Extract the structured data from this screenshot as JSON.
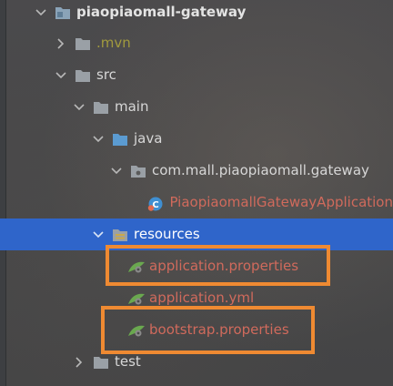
{
  "tree": {
    "project": {
      "label": "piaopiaomall-gateway"
    },
    "mvn": {
      "label": ".mvn"
    },
    "src": {
      "label": "src"
    },
    "main": {
      "label": "main"
    },
    "java": {
      "label": "java"
    },
    "package": {
      "label": "com.mall.piaopiaomall.gateway"
    },
    "app_class": {
      "label": "PiaopiaomallGatewayApplication"
    },
    "resources": {
      "label": "resources"
    },
    "app_props": {
      "label": "application.properties"
    },
    "app_yml": {
      "label": "application.yml"
    },
    "bootstrap_props": {
      "label": "bootstrap.properties"
    },
    "test": {
      "label": "test"
    }
  },
  "colors": {
    "selection": "#2f65ca",
    "highlight_box": "#ef8a32",
    "modified_file": "#d06a5c",
    "excluded_folder": "#a19a3e"
  }
}
